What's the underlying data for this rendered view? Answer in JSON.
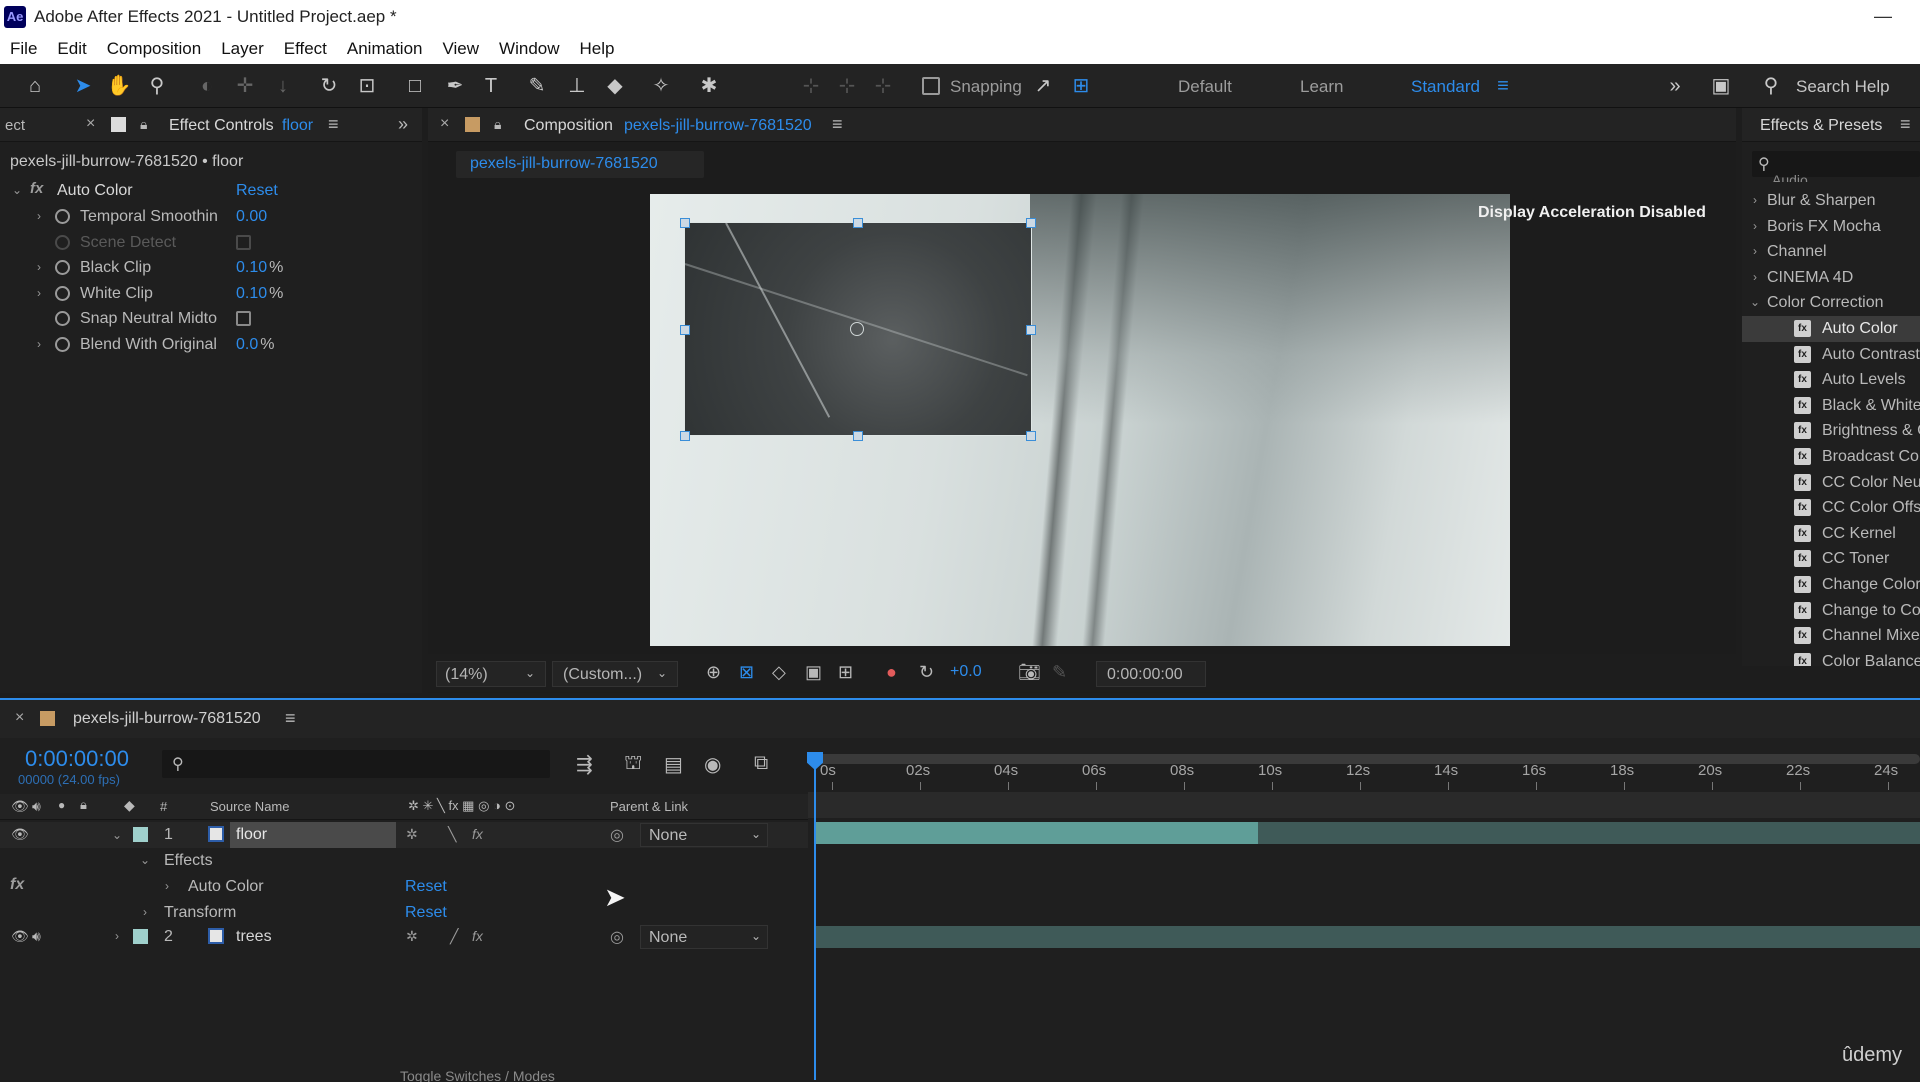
{
  "app": {
    "logo": "Ae",
    "title": "Adobe After Effects 2021 - Untitled Project.aep *",
    "minimize_glyph": "—"
  },
  "menu": [
    "File",
    "Edit",
    "Composition",
    "Layer",
    "Effect",
    "Animation",
    "View",
    "Window",
    "Help"
  ],
  "toolbar": {
    "snapping_label": "Snapping",
    "workspaces": [
      "Default",
      "Learn",
      "Standard"
    ],
    "active_workspace": "Standard",
    "search_help": "Search Help",
    "overflow_glyph": "»"
  },
  "effect_controls": {
    "left_tab_label": "ect",
    "tab_label": "Effect Controls",
    "tab_layer": "floor",
    "layer_path": "pexels-jill-burrow-7681520 • floor",
    "effect_name": "Auto Color",
    "reset_label": "Reset",
    "properties": [
      {
        "label": "Temporal Smoothin",
        "value": "0.00",
        "unit": "",
        "has_chevron": true,
        "kind": "value"
      },
      {
        "label": "Scene Detect",
        "value": "",
        "unit": "",
        "has_chevron": false,
        "kind": "checkbox",
        "disabled": true
      },
      {
        "label": "Black Clip",
        "value": "0.10",
        "unit": "%",
        "has_chevron": true,
        "kind": "value"
      },
      {
        "label": "White Clip",
        "value": "0.10",
        "unit": "%",
        "has_chevron": true,
        "kind": "value"
      },
      {
        "label": "Snap Neutral Midto",
        "value": "",
        "unit": "",
        "has_chevron": false,
        "kind": "checkbox"
      },
      {
        "label": "Blend With Original",
        "value": "0.0",
        "unit": "%",
        "has_chevron": true,
        "kind": "value"
      }
    ]
  },
  "composition": {
    "tab_label": "Composition",
    "tab_name": "pexels-jill-burrow-7681520",
    "subtab": "pexels-jill-burrow-7681520",
    "overlay_text": "Display Acceleration Disabled",
    "zoom": "(14%)",
    "resolution": "(Custom...)",
    "exposure": "+0.0",
    "timecode": "0:00:00:00"
  },
  "effects_presets": {
    "title": "Effects & Presets",
    "search_placeholder": "",
    "clipped_top": "Audio",
    "categories": [
      {
        "label": "Blur & Sharpen",
        "expanded": false
      },
      {
        "label": "Boris FX Mocha",
        "expanded": false
      },
      {
        "label": "Channel",
        "expanded": false
      },
      {
        "label": "CINEMA 4D",
        "expanded": false
      },
      {
        "label": "Color Correction",
        "expanded": true
      }
    ],
    "items": [
      {
        "label": "Auto Color",
        "selected": true
      },
      {
        "label": "Auto Contrast",
        "selected": false
      },
      {
        "label": "Auto Levels",
        "selected": false
      },
      {
        "label": "Black & White",
        "selected": false
      },
      {
        "label": "Brightness & Contrast",
        "selected": false
      },
      {
        "label": "Broadcast Colors",
        "selected": false
      },
      {
        "label": "CC Color Neutralizer",
        "selected": false
      },
      {
        "label": "CC Color Offset",
        "selected": false
      },
      {
        "label": "CC Kernel",
        "selected": false
      },
      {
        "label": "CC Toner",
        "selected": false
      },
      {
        "label": "Change Color",
        "selected": false
      },
      {
        "label": "Change to Color",
        "selected": false
      },
      {
        "label": "Channel Mixer",
        "selected": false
      },
      {
        "label": "Color Balance",
        "selected": false
      }
    ]
  },
  "timeline": {
    "tab_name": "pexels-jill-burrow-7681520",
    "timecode": "0:00:00:00",
    "frames": "00000 (24.00 fps)",
    "columns": {
      "number": "#",
      "source_name": "Source Name",
      "parent_link": "Parent & Link"
    },
    "ruler": [
      "0s",
      "02s",
      "04s",
      "06s",
      "08s",
      "10s",
      "12s",
      "14s",
      "16s",
      "18s",
      "20s",
      "22s",
      "24s"
    ],
    "layers": [
      {
        "number": "1",
        "name": "floor",
        "parent": "None",
        "selected": true
      },
      {
        "number": "2",
        "name": "trees",
        "parent": "None",
        "selected": false
      }
    ],
    "effects_group": "Effects",
    "effect_row": "Auto Color",
    "transform_row": "Transform",
    "reset_label": "Reset",
    "fx_label": "fx",
    "toggle_label": "Toggle Switches / Modes"
  },
  "watermark": "ûdemy",
  "colors": {
    "accent": "#2d8ceb",
    "layer_label": "#9fd0cc",
    "layer_bar": "#5f9e98"
  }
}
